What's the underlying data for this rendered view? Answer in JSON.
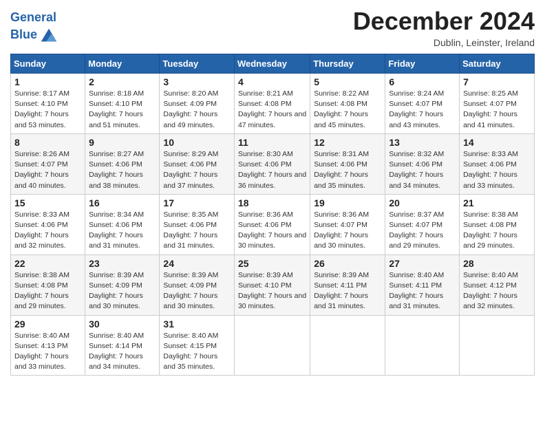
{
  "header": {
    "logo_line1": "General",
    "logo_line2": "Blue",
    "month_title": "December 2024",
    "location": "Dublin, Leinster, Ireland"
  },
  "weekdays": [
    "Sunday",
    "Monday",
    "Tuesday",
    "Wednesday",
    "Thursday",
    "Friday",
    "Saturday"
  ],
  "weeks": [
    [
      {
        "day": "1",
        "sunrise": "8:17 AM",
        "sunset": "4:10 PM",
        "daylight": "7 hours and 53 minutes."
      },
      {
        "day": "2",
        "sunrise": "8:18 AM",
        "sunset": "4:10 PM",
        "daylight": "7 hours and 51 minutes."
      },
      {
        "day": "3",
        "sunrise": "8:20 AM",
        "sunset": "4:09 PM",
        "daylight": "7 hours and 49 minutes."
      },
      {
        "day": "4",
        "sunrise": "8:21 AM",
        "sunset": "4:08 PM",
        "daylight": "7 hours and 47 minutes."
      },
      {
        "day": "5",
        "sunrise": "8:22 AM",
        "sunset": "4:08 PM",
        "daylight": "7 hours and 45 minutes."
      },
      {
        "day": "6",
        "sunrise": "8:24 AM",
        "sunset": "4:07 PM",
        "daylight": "7 hours and 43 minutes."
      },
      {
        "day": "7",
        "sunrise": "8:25 AM",
        "sunset": "4:07 PM",
        "daylight": "7 hours and 41 minutes."
      }
    ],
    [
      {
        "day": "8",
        "sunrise": "8:26 AM",
        "sunset": "4:07 PM",
        "daylight": "7 hours and 40 minutes."
      },
      {
        "day": "9",
        "sunrise": "8:27 AM",
        "sunset": "4:06 PM",
        "daylight": "7 hours and 38 minutes."
      },
      {
        "day": "10",
        "sunrise": "8:29 AM",
        "sunset": "4:06 PM",
        "daylight": "7 hours and 37 minutes."
      },
      {
        "day": "11",
        "sunrise": "8:30 AM",
        "sunset": "4:06 PM",
        "daylight": "7 hours and 36 minutes."
      },
      {
        "day": "12",
        "sunrise": "8:31 AM",
        "sunset": "4:06 PM",
        "daylight": "7 hours and 35 minutes."
      },
      {
        "day": "13",
        "sunrise": "8:32 AM",
        "sunset": "4:06 PM",
        "daylight": "7 hours and 34 minutes."
      },
      {
        "day": "14",
        "sunrise": "8:33 AM",
        "sunset": "4:06 PM",
        "daylight": "7 hours and 33 minutes."
      }
    ],
    [
      {
        "day": "15",
        "sunrise": "8:33 AM",
        "sunset": "4:06 PM",
        "daylight": "7 hours and 32 minutes."
      },
      {
        "day": "16",
        "sunrise": "8:34 AM",
        "sunset": "4:06 PM",
        "daylight": "7 hours and 31 minutes."
      },
      {
        "day": "17",
        "sunrise": "8:35 AM",
        "sunset": "4:06 PM",
        "daylight": "7 hours and 31 minutes."
      },
      {
        "day": "18",
        "sunrise": "8:36 AM",
        "sunset": "4:06 PM",
        "daylight": "7 hours and 30 minutes."
      },
      {
        "day": "19",
        "sunrise": "8:36 AM",
        "sunset": "4:07 PM",
        "daylight": "7 hours and 30 minutes."
      },
      {
        "day": "20",
        "sunrise": "8:37 AM",
        "sunset": "4:07 PM",
        "daylight": "7 hours and 29 minutes."
      },
      {
        "day": "21",
        "sunrise": "8:38 AM",
        "sunset": "4:08 PM",
        "daylight": "7 hours and 29 minutes."
      }
    ],
    [
      {
        "day": "22",
        "sunrise": "8:38 AM",
        "sunset": "4:08 PM",
        "daylight": "7 hours and 29 minutes."
      },
      {
        "day": "23",
        "sunrise": "8:39 AM",
        "sunset": "4:09 PM",
        "daylight": "7 hours and 30 minutes."
      },
      {
        "day": "24",
        "sunrise": "8:39 AM",
        "sunset": "4:09 PM",
        "daylight": "7 hours and 30 minutes."
      },
      {
        "day": "25",
        "sunrise": "8:39 AM",
        "sunset": "4:10 PM",
        "daylight": "7 hours and 30 minutes."
      },
      {
        "day": "26",
        "sunrise": "8:39 AM",
        "sunset": "4:11 PM",
        "daylight": "7 hours and 31 minutes."
      },
      {
        "day": "27",
        "sunrise": "8:40 AM",
        "sunset": "4:11 PM",
        "daylight": "7 hours and 31 minutes."
      },
      {
        "day": "28",
        "sunrise": "8:40 AM",
        "sunset": "4:12 PM",
        "daylight": "7 hours and 32 minutes."
      }
    ],
    [
      {
        "day": "29",
        "sunrise": "8:40 AM",
        "sunset": "4:13 PM",
        "daylight": "7 hours and 33 minutes."
      },
      {
        "day": "30",
        "sunrise": "8:40 AM",
        "sunset": "4:14 PM",
        "daylight": "7 hours and 34 minutes."
      },
      {
        "day": "31",
        "sunrise": "8:40 AM",
        "sunset": "4:15 PM",
        "daylight": "7 hours and 35 minutes."
      },
      null,
      null,
      null,
      null
    ]
  ],
  "labels": {
    "sunrise": "Sunrise:",
    "sunset": "Sunset:",
    "daylight": "Daylight:"
  }
}
